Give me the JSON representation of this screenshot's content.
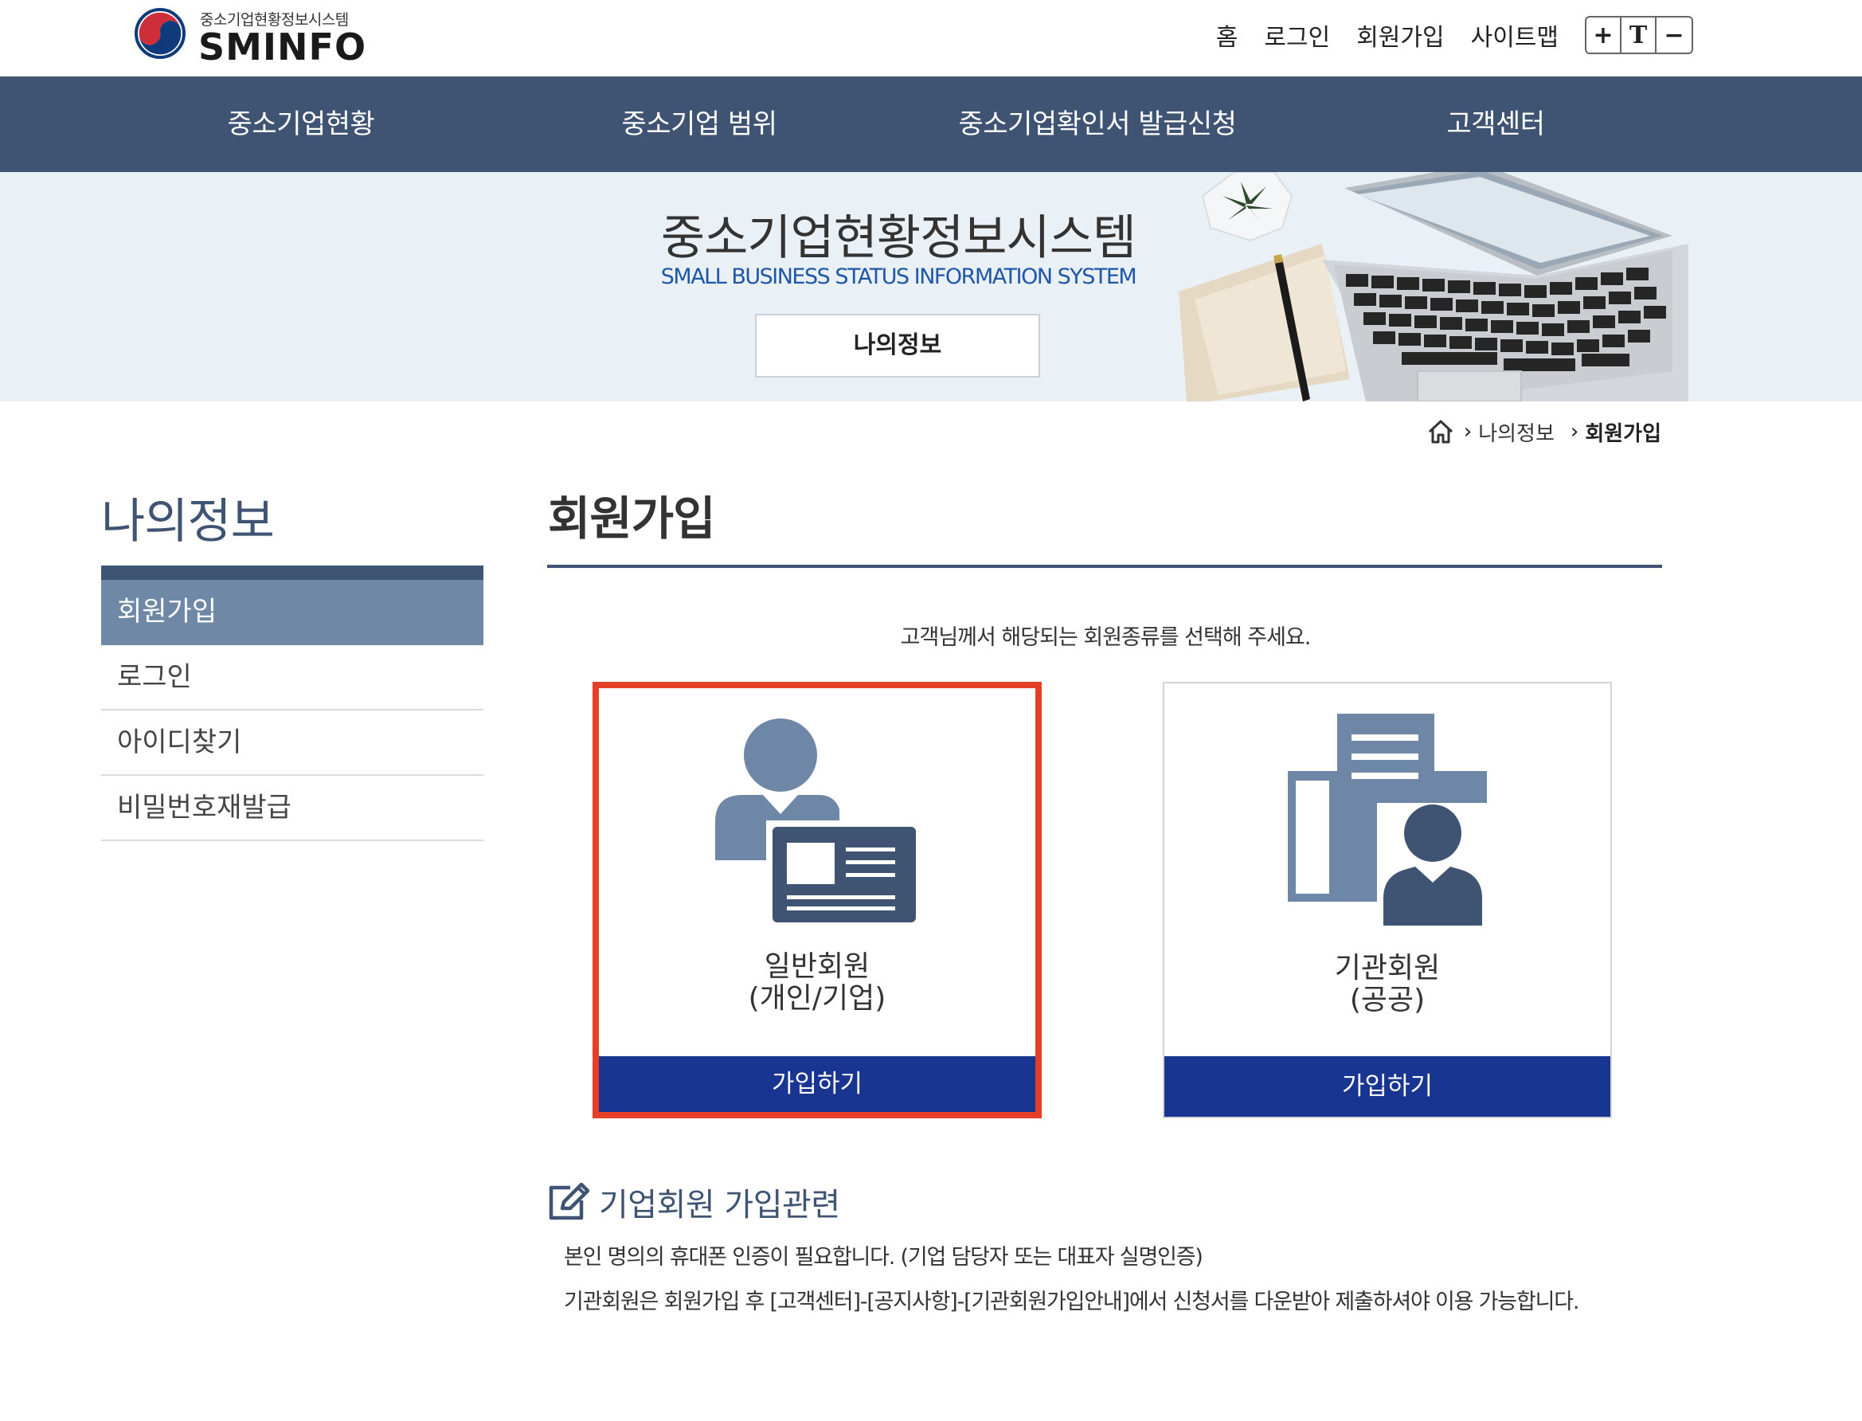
{
  "header": {
    "logo_sub": "중소기업현황정보시스템",
    "logo_main": "SMINFO",
    "util_links": [
      "홈",
      "로그인",
      "회원가입",
      "사이트맵"
    ],
    "font_controls": {
      "increase": "+",
      "reset": "T",
      "decrease": "−"
    }
  },
  "gnb": {
    "items": [
      "중소기업현황",
      "중소기업 범위",
      "중소기업확인서 발급신청",
      "고객센터"
    ]
  },
  "banner": {
    "title": "중소기업현황정보시스템",
    "subtitle": "SMALL BUSINESS STATUS INFORMATION SYSTEM",
    "button": "나의정보",
    "art_icon": "desk-laptop-illustration"
  },
  "breadcrumb": {
    "home_icon": "home-icon",
    "items": [
      "나의정보",
      "회원가입"
    ]
  },
  "sidebar": {
    "title": "나의정보",
    "items": [
      "회원가입",
      "로그인",
      "아이디찾기",
      "비밀번호재발급"
    ],
    "active_index": 0
  },
  "main": {
    "title": "회원가입",
    "instruction": "고객님께서 해당되는 회원종류를 선택해 주세요.",
    "cards": [
      {
        "icon": "person-id-card-icon",
        "label_line1": "일반회원",
        "label_line2": "(개인/기업)",
        "button": "가입하기",
        "selected": true
      },
      {
        "icon": "building-person-icon",
        "label_line1": "기관회원",
        "label_line2": "(공공)",
        "button": "가입하기",
        "selected": false
      }
    ]
  },
  "notice": {
    "icon": "edit-icon",
    "title": "기업회원 가입관련",
    "lines": [
      "본인 명의의 휴대폰 인증이 필요합니다. (기업 담당자 또는 대표자 실명인증)",
      "기관회원은 회원가입 후 [고객센터]-[공지사항]-[기관회원가입안내]에서 신청서를 다운받아 제출하셔야 이용 가능합니다."
    ]
  },
  "colors": {
    "nav_bg": "#3f5373",
    "sidebar_active": "#6e88a6",
    "button_blue": "#183592",
    "selection_red": "#e53f28",
    "banner_bg": "#eaf1f6",
    "subtitle_blue": "#1e56a8"
  }
}
